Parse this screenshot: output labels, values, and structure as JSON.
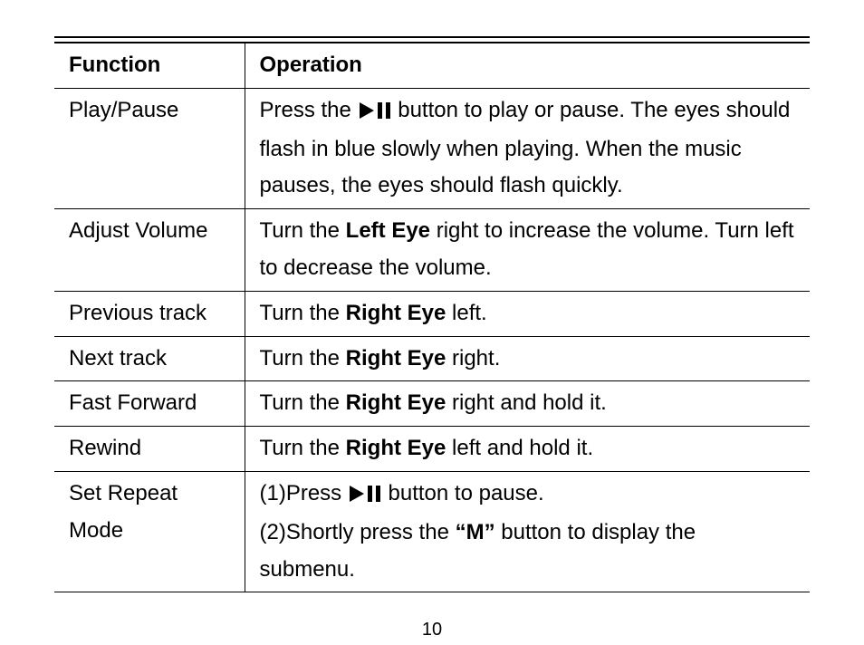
{
  "page_number": "10",
  "headers": {
    "function": "Function",
    "operation": "Operation"
  },
  "rows": {
    "play_pause": {
      "func": "Play/Pause",
      "op_pre": "Press the ",
      "op_post": " button to play or pause. The eyes should flash in blue slowly when playing. When the music pauses, the eyes should flash quickly."
    },
    "adjust_volume": {
      "func": "Adjust Volume",
      "op_pre": "Turn the ",
      "op_bold": "Left Eye",
      "op_post": " right to increase the volume. Turn left to decrease the volume."
    },
    "previous_track": {
      "func": "Previous track",
      "op_pre": "Turn the ",
      "op_bold": "Right Eye",
      "op_post": " left."
    },
    "next_track": {
      "func": "Next track",
      "op_pre": "Turn the ",
      "op_bold": "Right Eye",
      "op_post": " right."
    },
    "fast_forward": {
      "func": "Fast Forward",
      "op_pre": "Turn the ",
      "op_bold": "Right Eye",
      "op_post": " right and hold it."
    },
    "rewind": {
      "func": "Rewind",
      "op_pre": "Turn the ",
      "op_bold": "Right Eye",
      "op_post": " left and hold it."
    },
    "set_repeat": {
      "func": "Set Repeat Mode",
      "line1_pre": "(1)Press ",
      "line1_post": " button to pause.",
      "line2_pre": "(2)Shortly press the ",
      "line2_bold": "“M”",
      "line2_post": " button to display the submenu."
    }
  }
}
